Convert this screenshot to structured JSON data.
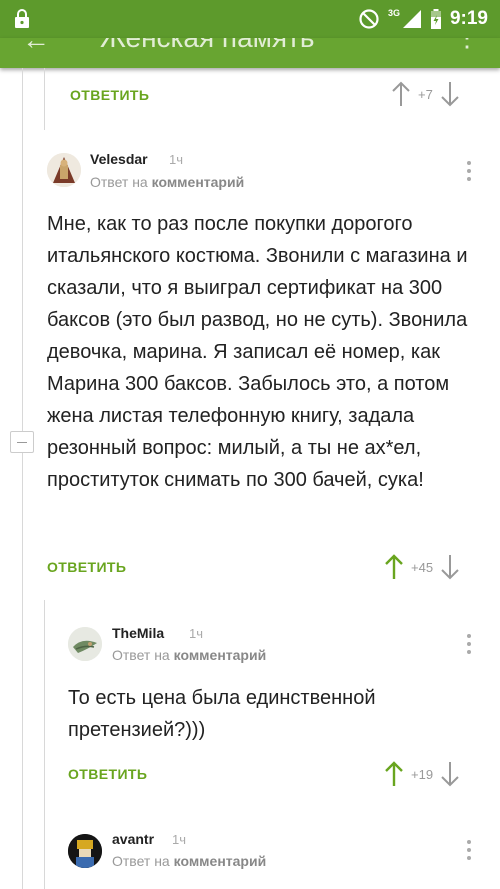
{
  "status_bar": {
    "network": "3G",
    "time": "9:19"
  },
  "toolbar": {
    "title": "Женская память",
    "back": "←",
    "more": "⋮"
  },
  "actions": {
    "reply_label": "ОТВЕТИТЬ"
  },
  "top_item": {
    "score": "+7"
  },
  "comments": [
    {
      "author": "Velesdar",
      "age": "1ч",
      "reply_prefix": "Ответ на",
      "reply_target": "комментарий",
      "text": "Мне, как то раз после покупки дорогого итальянского костюма. Звонили с магазина и сказали, что я выиграл сертификат на 300 баксов (это был развод, но не суть). Звонила девочка, марина. Я записал её номер, как Марина 300 баксов. Забылось это, а потом жена листая телефонную книгу, задала резонный вопрос: милый, а ты не ах*ел, проституток снимать по 300 бачей, сука!",
      "score": "+45"
    },
    {
      "author": "TheMila",
      "age": "1ч",
      "reply_prefix": "Ответ на",
      "reply_target": "комментарий",
      "text": "То есть цена была единственной претензией?)))",
      "score": "+19"
    },
    {
      "author": "avantr",
      "age": "1ч",
      "reply_prefix": "Ответ на",
      "reply_target": "комментарий"
    }
  ],
  "colors": {
    "status": "#5d9a2c",
    "toolbar": "#68a531",
    "accent": "#69a51f"
  }
}
